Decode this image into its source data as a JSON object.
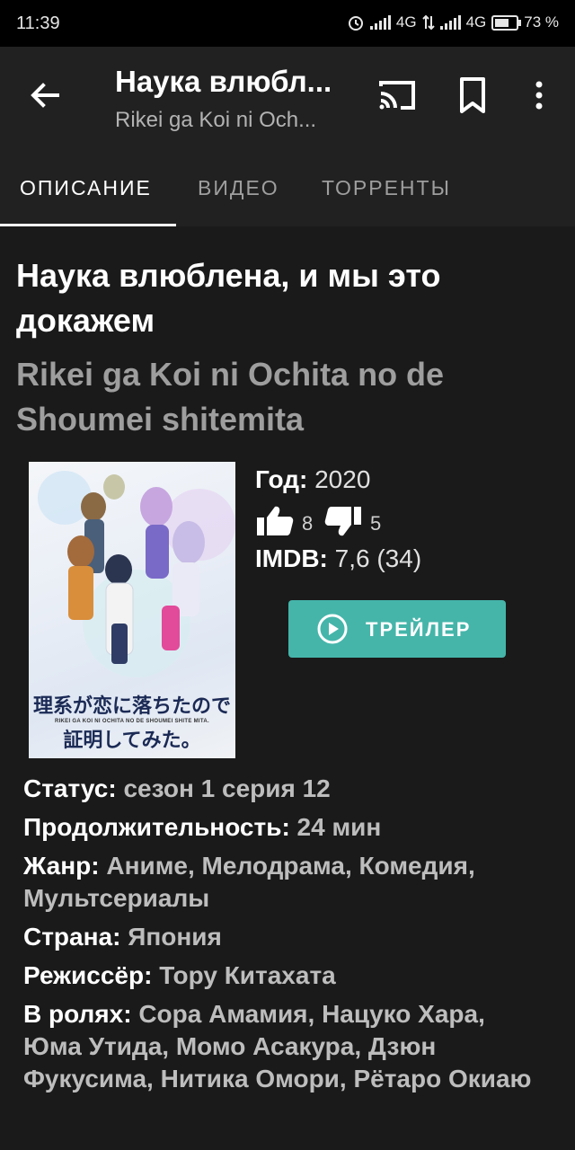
{
  "status_bar": {
    "time": "11:39",
    "network1": "4G",
    "network2": "4G",
    "battery": "73 %"
  },
  "toolbar": {
    "title": "Наука влюбл...",
    "subtitle": "Rikei ga Koi ni Och..."
  },
  "tabs": [
    {
      "label": "ОПИСАНИЕ",
      "active": true
    },
    {
      "label": "ВИДЕО",
      "active": false
    },
    {
      "label": "ТОРРЕНТЫ",
      "active": false
    }
  ],
  "movie": {
    "title": "Наука влюблена, и мы это докажем",
    "original_title": "Rikei ga Koi ni Ochita no de Shoumei shitemita",
    "poster": {
      "line1": "理系が恋に落ちたので",
      "romaji": "RIKEI GA KOI NI OCHITA NO DE SHOUMEI SHITE MITA.",
      "line2": "証明してみた。"
    },
    "year_label": "Год",
    "year": "2020",
    "likes": "8",
    "dislikes": "5",
    "imdb_label": "IMDB",
    "imdb": "7,6 (34)",
    "trailer_label": "ТРЕЙЛЕР"
  },
  "details": [
    {
      "label": "Статус",
      "value": "сезон 1 серия 12"
    },
    {
      "label": "Продолжительность",
      "value": "24 мин"
    },
    {
      "label": "Жанр",
      "value": "Аниме, Мелодрама, Комедия, Мультсериалы"
    },
    {
      "label": "Страна",
      "value": "Япония"
    },
    {
      "label": "Режиссёр",
      "value": "Тору Китахата"
    },
    {
      "label": "В ролях",
      "value": "Сора Амамия, Нацуко Хара, Юма Утида, Момо Асакура, Дзюн Фукусима, Нитика Омори, Рётаро Окиаю"
    }
  ],
  "colors": {
    "accent": "#45b5aa",
    "background": "#1a1a1a",
    "toolbar": "#212121"
  }
}
